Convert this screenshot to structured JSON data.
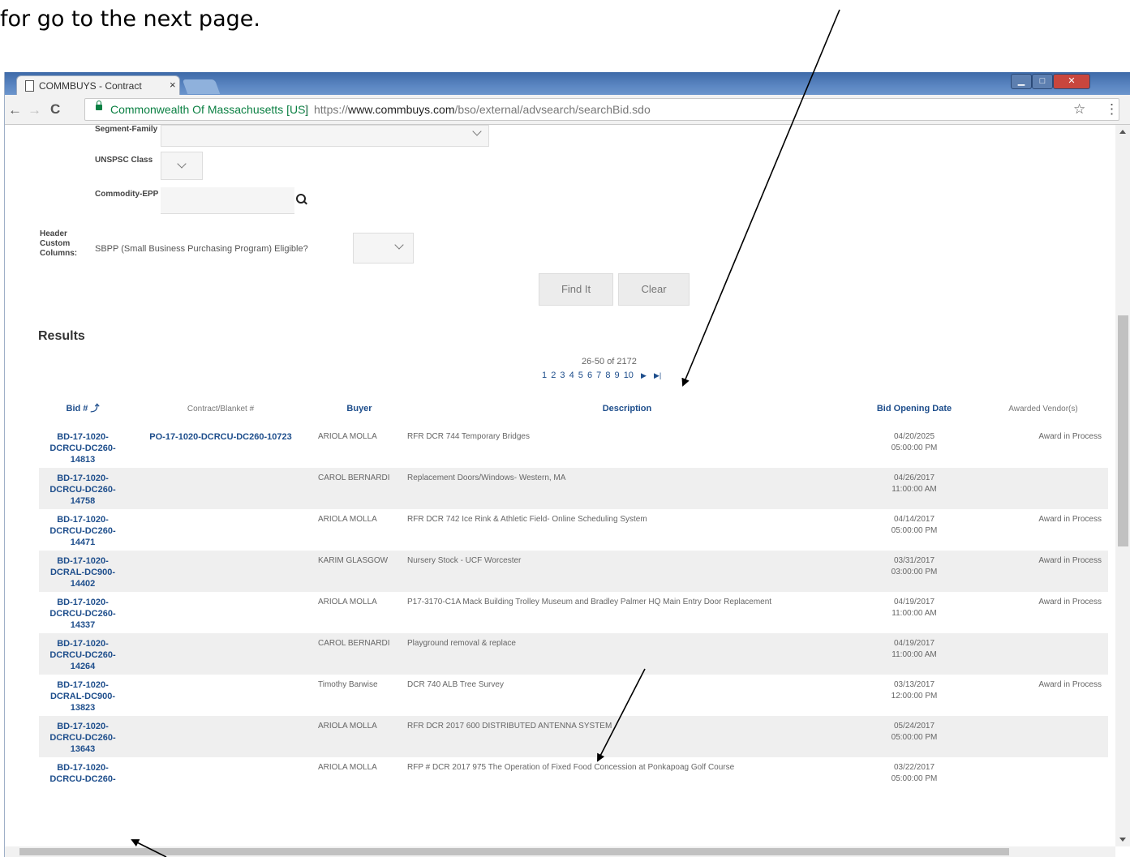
{
  "caption": "for go to the next page.",
  "browser": {
    "tab_title": "COMMBUYS - Contract",
    "tab_close": "×",
    "secure_name": "Commonwealth Of Massachusetts [US]",
    "url_prefix": "https://",
    "url_domain": "www.commbuys.com",
    "url_path": "/bso/external/advsearch/searchBid.sdo",
    "nav_back": "←",
    "nav_forward": "→",
    "nav_reload": "C",
    "star": "☆",
    "menu": "⋮",
    "window_controls": [
      "▁",
      "□",
      "✕"
    ]
  },
  "form": {
    "segment_label": "Segment-Family",
    "unspsc_label": "UNSPSC Class",
    "commodity_label": "Commodity-EPP",
    "header_label": "Header Custom Columns:",
    "custom_column": "SBPP (Small Business Purchasing Program) Eligible?",
    "find_button": "Find It",
    "clear_button": "Clear"
  },
  "results": {
    "title": "Results",
    "count": "26-50 of 2172",
    "pages": [
      "1",
      "2",
      "3",
      "4",
      "5",
      "6",
      "7",
      "8",
      "9",
      "10"
    ],
    "next": "▶",
    "last": "▶|",
    "columns": [
      "Bid #",
      "Contract/Blanket #",
      "Buyer",
      "Description",
      "Bid Opening Date",
      "Awarded Vendor(s)"
    ],
    "rows": [
      {
        "bid": "BD-17-1020-DCRCU-DC260-14813",
        "contract": "PO-17-1020-DCRCU-DC260-10723",
        "buyer": "ARIOLA MOLLA",
        "description": "RFR DCR 744 Temporary Bridges",
        "date": "04/20/2025",
        "time": "05:00:00 PM",
        "awarded": "Award in Process"
      },
      {
        "bid": "BD-17-1020-DCRCU-DC260-14758",
        "contract": "",
        "buyer": "CAROL BERNARDI",
        "description": "Replacement Doors/Windows- Western, MA",
        "date": "04/26/2017",
        "time": "11:00:00 AM",
        "awarded": ""
      },
      {
        "bid": "BD-17-1020-DCRCU-DC260-14471",
        "contract": "",
        "buyer": "ARIOLA MOLLA",
        "description": "RFR DCR 742 Ice Rink & Athletic Field- Online Scheduling System",
        "date": "04/14/2017",
        "time": "05:00:00 PM",
        "awarded": "Award in Process"
      },
      {
        "bid": "BD-17-1020-DCRAL-DC900-14402",
        "contract": "",
        "buyer": "KARIM GLASGOW",
        "description": "Nursery Stock - UCF Worcester",
        "date": "03/31/2017",
        "time": "03:00:00 PM",
        "awarded": "Award in Process"
      },
      {
        "bid": "BD-17-1020-DCRCU-DC260-14337",
        "contract": "",
        "buyer": "ARIOLA MOLLA",
        "description": "P17-3170-C1A Mack Building Trolley Museum and Bradley Palmer HQ Main Entry Door Replacement",
        "date": "04/19/2017",
        "time": "11:00:00 AM",
        "awarded": "Award in Process"
      },
      {
        "bid": "BD-17-1020-DCRCU-DC260-14264",
        "contract": "",
        "buyer": "CAROL BERNARDI",
        "description": "Playground removal & replace",
        "date": "04/19/2017",
        "time": "11:00:00 AM",
        "awarded": ""
      },
      {
        "bid": "BD-17-1020-DCRAL-DC900-13823",
        "contract": "",
        "buyer": "Timothy Barwise",
        "description": "DCR 740 ALB Tree Survey",
        "date": "03/13/2017",
        "time": "12:00:00 PM",
        "awarded": "Award in Process"
      },
      {
        "bid": "BD-17-1020-DCRCU-DC260-13643",
        "contract": "",
        "buyer": "ARIOLA MOLLA",
        "description": "RFR DCR 2017 600 DISTRIBUTED ANTENNA SYSTEM",
        "date": "05/24/2017",
        "time": "05:00:00 PM",
        "awarded": ""
      },
      {
        "bid": "BD-17-1020-DCRCU-DC260-",
        "contract": "",
        "buyer": "ARIOLA MOLLA",
        "description": "RFP # DCR 2017 975 The Operation of Fixed Food Concession at Ponkapoag Golf Course",
        "date": "03/22/2017",
        "time": "05:00:00 PM",
        "awarded": ""
      }
    ]
  },
  "icons": [
    "page-icon",
    "lock-icon",
    "search-icon",
    "sort-icon",
    "chevron-down-icon",
    "star-icon",
    "menu-icon",
    "annotation-arrow-icon"
  ]
}
